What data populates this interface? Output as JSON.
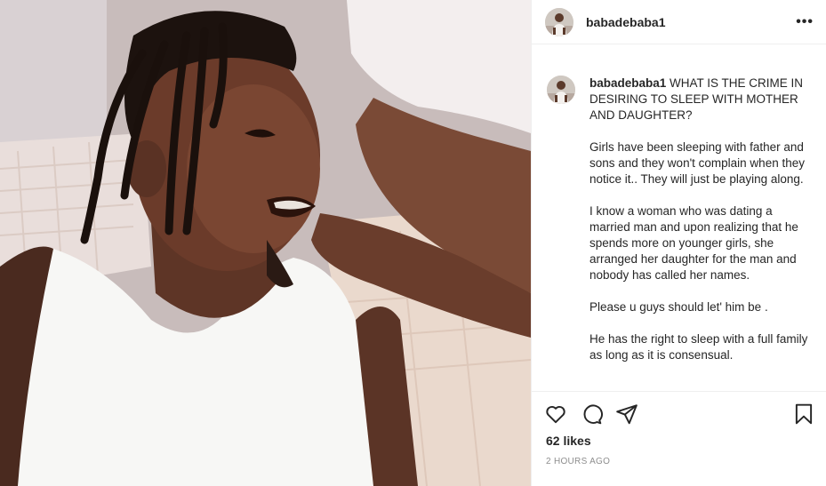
{
  "post": {
    "username": "babadebaba1",
    "more_label": "•••",
    "caption_username": "babadebaba1",
    "caption_title": "WHAT IS THE CRIME IN DESIRING TO SLEEP WITH MOTHER AND DAUGHTER?",
    "caption_paragraphs": [
      "Girls have been sleeping with father and sons and they won't complain when they notice it.. They will just be playing along.",
      "I know a woman who was dating a married man and upon realizing that he spends more on younger girls, she arranged her daughter for the man and nobody has called her names.",
      "Please u guys should let' him be .",
      "He has the right to sleep with a full family as long as it is consensual."
    ],
    "likes_label": "62 likes",
    "timestamp": "2 HOURS AGO"
  },
  "icons": {
    "like": "heart-icon",
    "comment": "comment-icon",
    "share": "share-icon",
    "save": "bookmark-icon",
    "more": "more-options-icon"
  },
  "colors": {
    "text": "#262626",
    "muted": "#8e8e8e",
    "divider": "#efefef"
  }
}
